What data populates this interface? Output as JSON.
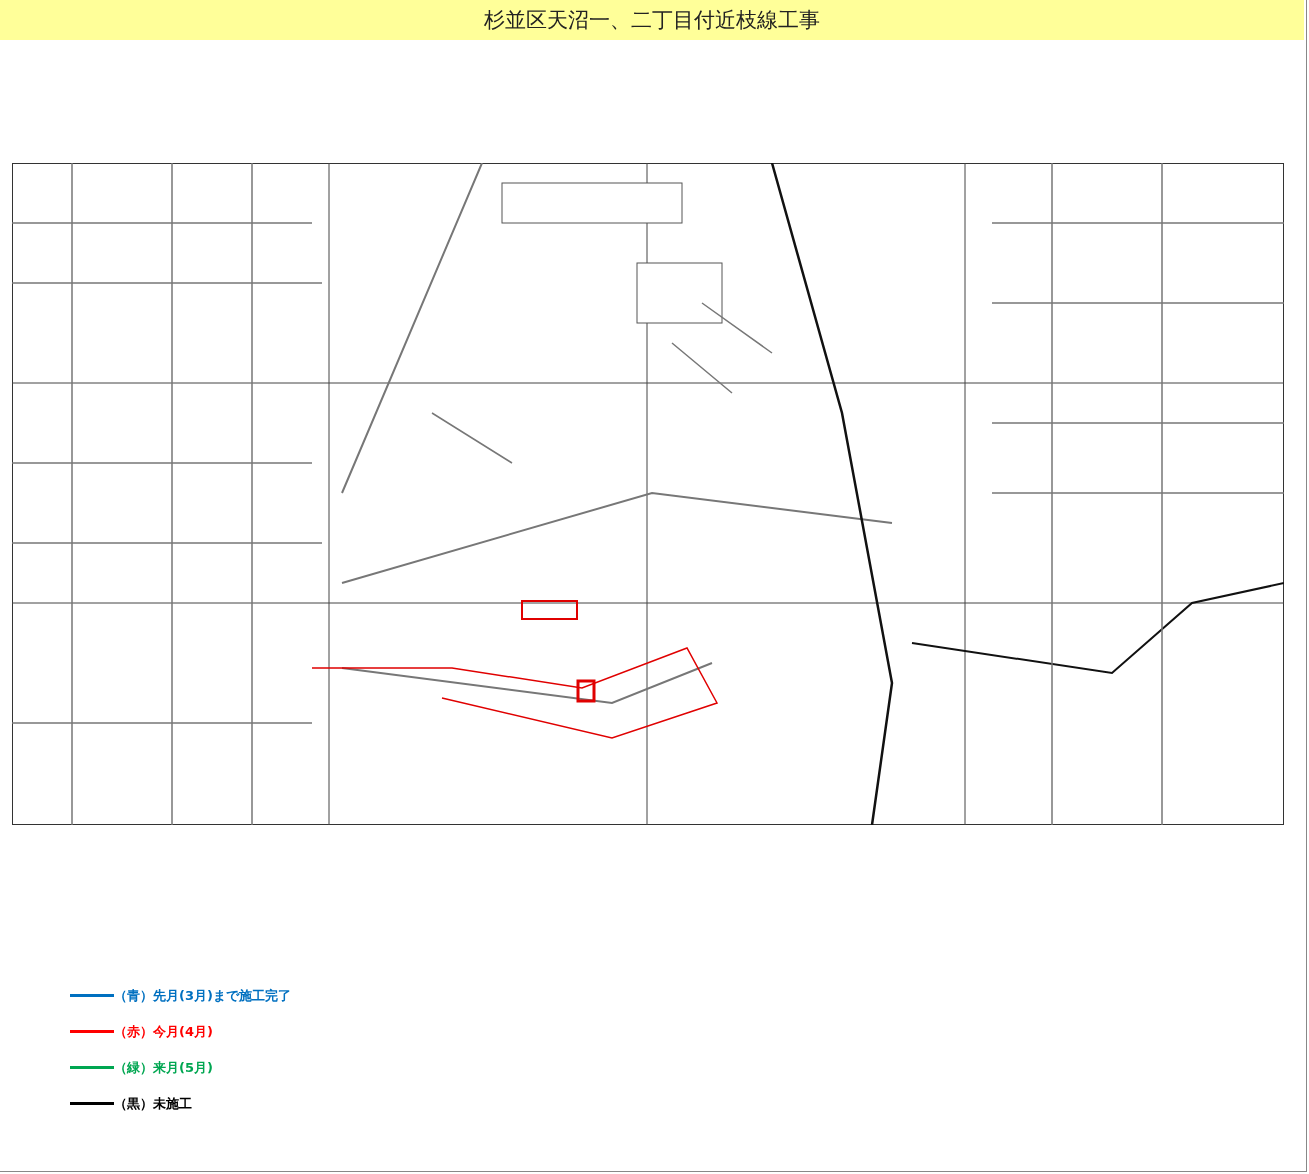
{
  "title": "杉並区天沼一、二丁目付近枝線工事",
  "legend": [
    {
      "label": "（青）先月(3月)まで施工完了",
      "color": "#0070c0"
    },
    {
      "label": "（赤）今月(4月)",
      "color": "#ff0000"
    },
    {
      "label": "（緑）来月(5月)",
      "color": "#00a651"
    },
    {
      "label": "（黒）未施工",
      "color": "#000000"
    }
  ]
}
